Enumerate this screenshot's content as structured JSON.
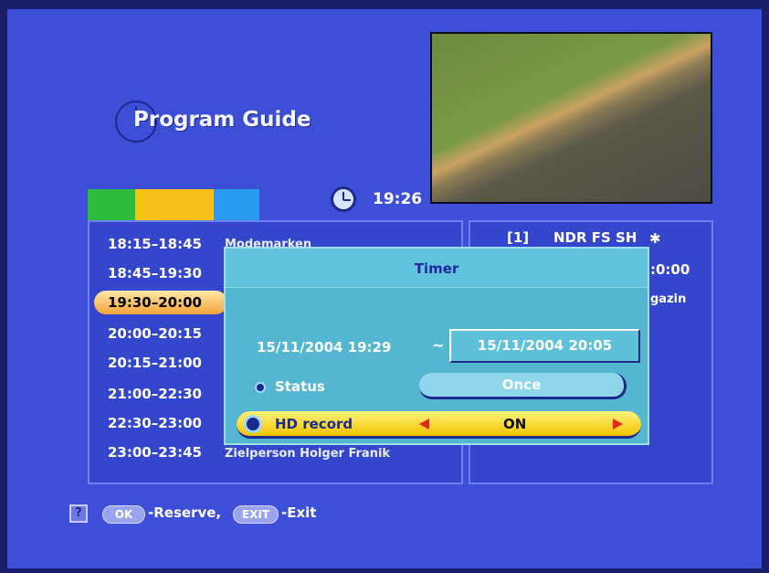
{
  "header": {
    "title": "Program Guide",
    "clock_time": "19:26"
  },
  "color_keys": {
    "colors": [
      "#2ebd3a",
      "#f6c21a",
      "#2a9cf0"
    ]
  },
  "schedule": {
    "slots": [
      {
        "time": "18:15–18:45",
        "title": "Modemarken"
      },
      {
        "time": "18:45–19:30",
        "title": ""
      },
      {
        "time": "19:30–20:00",
        "title": ""
      },
      {
        "time": "20:00–20:15",
        "title": ""
      },
      {
        "time": "20:15–21:00",
        "title": ""
      },
      {
        "time": "21:00–22:30",
        "title": ""
      },
      {
        "time": "22:30–23:00",
        "title": ""
      },
      {
        "time": "23:00–23:45",
        "title": "Zielperson Holger Franik"
      }
    ],
    "selected_index": 2
  },
  "channel_info": {
    "channel_number": "[1]",
    "channel_name": "NDR FS SH",
    "end_time_fragment": ":0:00",
    "desc_fragment": "gazin"
  },
  "timer_dialog": {
    "title": "Timer",
    "start": "15/11/2004 19:29",
    "separator": "~",
    "end": "15/11/2004 20:05",
    "status_label": "Status",
    "status_value": "Once",
    "hd_label": "HD record",
    "hd_value": "ON"
  },
  "footer": {
    "help_icon": "?",
    "ok_key": "OK",
    "ok_text": "-Reserve,",
    "exit_key": "EXIT",
    "exit_text": "-Exit"
  }
}
